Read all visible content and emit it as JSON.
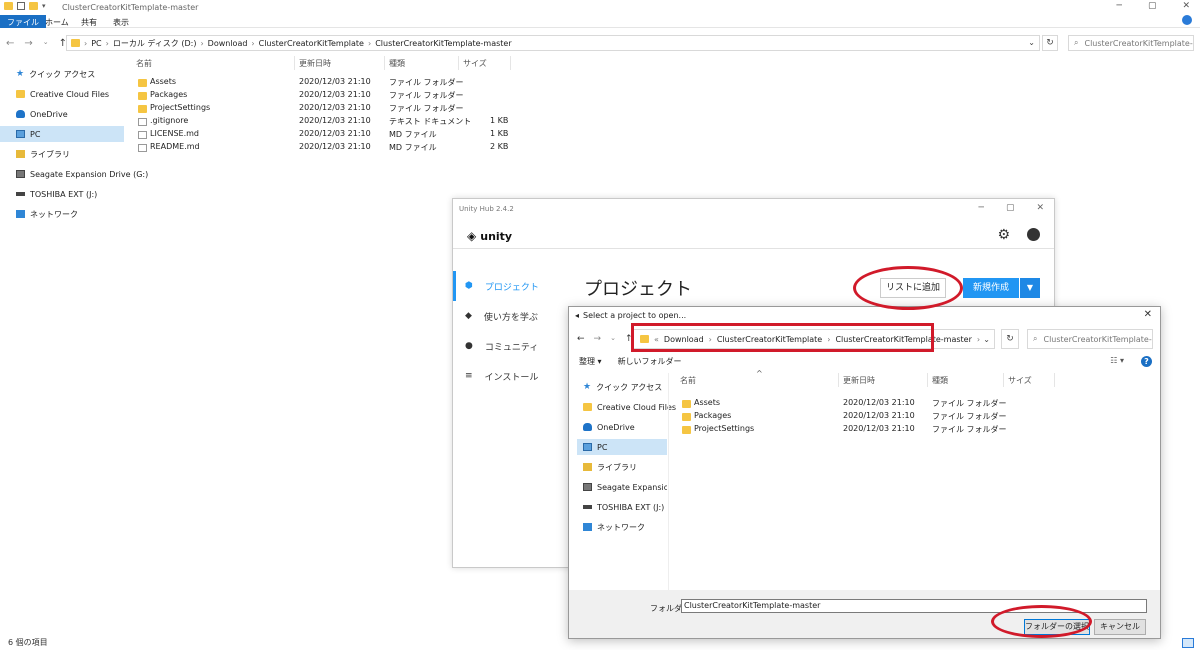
{
  "explorer": {
    "title": "ClusterCreatorKitTemplate-master",
    "ribbon_tabs": [
      "ファイル",
      "ホーム",
      "共有",
      "表示"
    ],
    "breadcrumb": [
      "PC",
      "ローカル ディスク (D:)",
      "Download",
      "ClusterCreatorKitTemplate",
      "ClusterCreatorKitTemplate-master"
    ],
    "search_placeholder": "ClusterCreatorKitTemplate-m...",
    "sidebar": [
      {
        "label": "クイック アクセス",
        "icon": "star-icon"
      },
      {
        "label": "Creative Cloud Files",
        "icon": "creative-cloud-icon"
      },
      {
        "label": "OneDrive",
        "icon": "cloud-icon"
      },
      {
        "label": "PC",
        "icon": "pc-icon",
        "selected": true
      },
      {
        "label": "ライブラリ",
        "icon": "library-icon"
      },
      {
        "label": "Seagate Expansion Drive (G:)",
        "icon": "drive-icon"
      },
      {
        "label": "TOSHIBA EXT (J:)",
        "icon": "usb-drive-icon"
      },
      {
        "label": "ネットワーク",
        "icon": "network-icon"
      }
    ],
    "columns": [
      "名前",
      "更新日時",
      "種類",
      "サイズ"
    ],
    "files": [
      {
        "name": "Assets",
        "date": "2020/12/03 21:10",
        "type": "ファイル フォルダー",
        "size": "",
        "kind": "folder"
      },
      {
        "name": "Packages",
        "date": "2020/12/03 21:10",
        "type": "ファイル フォルダー",
        "size": "",
        "kind": "folder"
      },
      {
        "name": "ProjectSettings",
        "date": "2020/12/03 21:10",
        "type": "ファイル フォルダー",
        "size": "",
        "kind": "folder"
      },
      {
        "name": ".gitignore",
        "date": "2020/12/03 21:10",
        "type": "テキスト ドキュメント",
        "size": "1 KB",
        "kind": "file"
      },
      {
        "name": "LICENSE.md",
        "date": "2020/12/03 21:10",
        "type": "MD ファイル",
        "size": "1 KB",
        "kind": "file"
      },
      {
        "name": "README.md",
        "date": "2020/12/03 21:10",
        "type": "MD ファイル",
        "size": "2 KB",
        "kind": "file"
      }
    ],
    "status": "6 個の項目"
  },
  "hub": {
    "window_title": "Unity Hub 2.4.2",
    "logo_text": "unity",
    "nav": [
      {
        "label": "プロジェクト",
        "icon": "cube-icon",
        "active": true
      },
      {
        "label": "使い方を学ぶ",
        "icon": "graduation-cap-icon"
      },
      {
        "label": "コミュニティ",
        "icon": "people-icon"
      },
      {
        "label": "インストール",
        "icon": "list-icon"
      }
    ],
    "heading": "プロジェクト",
    "add_button": "リストに追加",
    "new_button": "新規作成"
  },
  "dialog": {
    "title": "Select a project to open...",
    "breadcrumb": [
      "Download",
      "ClusterCreatorKitTemplate",
      "ClusterCreatorKitTemplate-master"
    ],
    "search_placeholder": "ClusterCreatorKitTemplate-m...",
    "toolbar": {
      "organize": "整理 ▾",
      "new_folder": "新しいフォルダー"
    },
    "sidebar": [
      {
        "label": "クイック アクセス",
        "icon": "star-icon"
      },
      {
        "label": "Creative Cloud Files",
        "icon": "creative-cloud-icon"
      },
      {
        "label": "OneDrive",
        "icon": "cloud-icon"
      },
      {
        "label": "PC",
        "icon": "pc-icon",
        "selected": true
      },
      {
        "label": "ライブラリ",
        "icon": "library-icon"
      },
      {
        "label": "Seagate Expansion Di",
        "icon": "drive-icon"
      },
      {
        "label": "TOSHIBA EXT (J:)",
        "icon": "usb-drive-icon"
      },
      {
        "label": "ネットワーク",
        "icon": "network-icon"
      }
    ],
    "columns": [
      "名前",
      "更新日時",
      "種類",
      "サイズ"
    ],
    "files": [
      {
        "name": "Assets",
        "date": "2020/12/03 21:10",
        "type": "ファイル フォルダー"
      },
      {
        "name": "Packages",
        "date": "2020/12/03 21:10",
        "type": "ファイル フォルダー"
      },
      {
        "name": "ProjectSettings",
        "date": "2020/12/03 21:10",
        "type": "ファイル フォルダー"
      }
    ],
    "folder_label": "フォルダー:",
    "folder_value": "ClusterCreatorKitTemplate-master",
    "select_button": "フォルダーの選択",
    "cancel_button": "キャンセル"
  }
}
